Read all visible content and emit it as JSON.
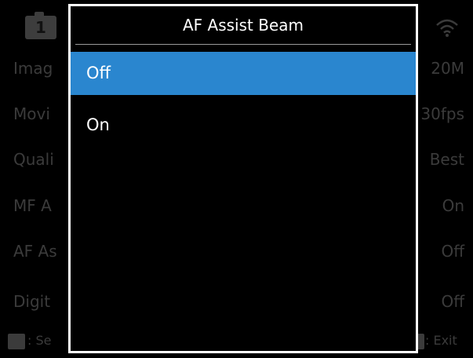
{
  "background_menu": {
    "tab_number": "1",
    "rows": [
      {
        "label": "Imag",
        "value": "20M"
      },
      {
        "label": "Movi",
        "value": "30fps"
      },
      {
        "label": "Quali",
        "value": "Best"
      },
      {
        "label": "MF A",
        "value": "On"
      },
      {
        "label": "AF As",
        "value": "Off"
      },
      {
        "label": "Digit",
        "value": "Off"
      }
    ],
    "footer": {
      "left_label": ": Se",
      "right_label": ": Exit"
    }
  },
  "dialog": {
    "title": "AF Assist Beam",
    "options": [
      {
        "label": "Off",
        "selected": true
      },
      {
        "label": "On",
        "selected": false
      }
    ]
  },
  "colors": {
    "selection": "#2a86cf",
    "dimmed_text": "#3b3b3b",
    "border": "#ffffff"
  }
}
